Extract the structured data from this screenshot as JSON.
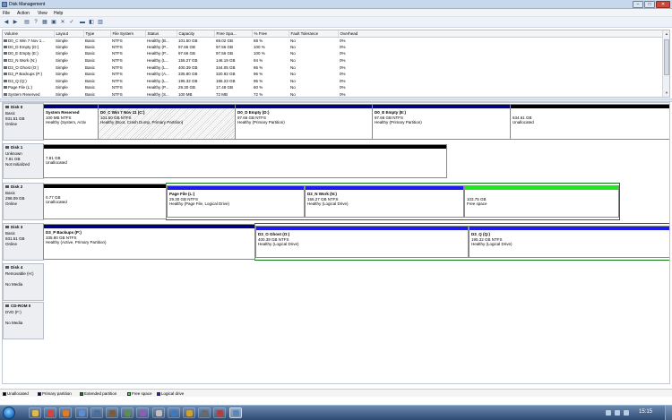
{
  "window": {
    "title": "Disk Management"
  },
  "window_controls": {
    "minimize": "–",
    "maximize": "□",
    "close": "✕"
  },
  "menu": [
    {
      "label": "File"
    },
    {
      "label": "Action"
    },
    {
      "label": "View"
    },
    {
      "label": "Help"
    }
  ],
  "toolbar": [
    {
      "name": "back-icon",
      "glyph": "◀"
    },
    {
      "name": "forward-icon",
      "glyph": "▶"
    },
    {
      "name": "console-tree-icon",
      "glyph": "▤"
    },
    {
      "name": "help-icon",
      "glyph": "?"
    },
    {
      "name": "properties-icon",
      "glyph": "▦"
    },
    {
      "name": "connect-drive-icon",
      "glyph": "▣"
    },
    {
      "name": "delete-icon",
      "glyph": "✕"
    },
    {
      "name": "check-icon",
      "glyph": "✓"
    },
    {
      "name": "open-folder-icon",
      "glyph": "▬"
    },
    {
      "name": "explore-icon",
      "glyph": "◧"
    },
    {
      "name": "view-icon",
      "glyph": "▥"
    }
  ],
  "volumes": {
    "columns": [
      "Volume",
      "Layout",
      "Type",
      "File System",
      "Status",
      "Capacity",
      "Free Spa...",
      "% Free",
      "Fault Tolerance",
      "Overhead"
    ],
    "rows": [
      [
        "D0_C Win 7 Nov 1...",
        "Simple",
        "Basic",
        "NTFS",
        "Healthy (B...",
        "101.50 GB",
        "69.02 GB",
        "68 %",
        "No",
        "0%"
      ],
      [
        "D0_D Empty (D:)",
        "Simple",
        "Basic",
        "NTFS",
        "Healthy (P...",
        "97.66 GB",
        "97.56 GB",
        "100 %",
        "No",
        "0%"
      ],
      [
        "D0_E Empty (E:)",
        "Simple",
        "Basic",
        "NTFS",
        "Healthy (P...",
        "97.66 GB",
        "97.56 GB",
        "100 %",
        "No",
        "0%"
      ],
      [
        "D2_N Work (N:)",
        "Simple",
        "Basic",
        "NTFS",
        "Healthy (L...",
        "155.27 GB",
        "146.19 GB",
        "94 %",
        "No",
        "0%"
      ],
      [
        "D3_O Ghost (O:)",
        "Simple",
        "Basic",
        "NTFS",
        "Healthy (L...",
        "400.39 GB",
        "344.05 GB",
        "86 %",
        "No",
        "0%"
      ],
      [
        "D3_P Backups (P:)",
        "Simple",
        "Basic",
        "NTFS",
        "Healthy (A...",
        "335.80 GB",
        "320.92 GB",
        "96 %",
        "No",
        "0%"
      ],
      [
        "D3_Q (Q:)",
        "Simple",
        "Basic",
        "NTFS",
        "Healthy (L...",
        "195.32 GB",
        "186.23 GB",
        "95 %",
        "No",
        "0%"
      ],
      [
        "Page File (L:)",
        "Simple",
        "Basic",
        "NTFS",
        "Healthy (P...",
        "29.30 GB",
        "17.48 GB",
        "60 %",
        "No",
        "0%"
      ],
      [
        "System Reserved",
        "Simple",
        "Basic",
        "NTFS",
        "Healthy (S...",
        "100 MB",
        "72 MB",
        "72 %",
        "No",
        "0%"
      ]
    ]
  },
  "disks": [
    {
      "name": "Disk 0",
      "lines": [
        "Basic",
        "931.51 GB",
        "Online"
      ],
      "partitions": [
        {
          "kind": "primary",
          "lines": [
            "System Reserved",
            "100 MB NTFS",
            "Healthy (System, Activ"
          ]
        },
        {
          "kind": "primary-selected",
          "lines": [
            "D0_C Win 7 Nov 11  (C:)",
            "101.50 GB NTFS",
            "Healthy (Boot, Crash Dump, Primary Partition)"
          ]
        },
        {
          "kind": "primary",
          "lines": [
            "D0_D Empty  (D:)",
            "97.66 GB NTFS",
            "Healthy (Primary Partition)"
          ]
        },
        {
          "kind": "primary",
          "lines": [
            "D0_E Empty  (E:)",
            "97.66 GB NTFS",
            "Healthy (Primary Partition)"
          ]
        },
        {
          "kind": "unallocated",
          "lines": [
            "",
            "634.61 GB",
            "Unallocated"
          ]
        }
      ]
    },
    {
      "name": "Disk 1",
      "lines": [
        "Unknown",
        "7.81 GB",
        "Not Initialized"
      ],
      "partitions": [
        {
          "kind": "unallocated",
          "lines": [
            "",
            "7.81 GB",
            "Unallocated"
          ]
        }
      ]
    },
    {
      "name": "Disk 2",
      "lines": [
        "Basic",
        "298.09 GB",
        "Online"
      ],
      "partitions": [
        {
          "kind": "unallocated",
          "lines": [
            "",
            "0.77 GB",
            "Unallocated"
          ]
        },
        {
          "kind": "logical",
          "lines": [
            "Page File  (L:)",
            "29.30 GB NTFS",
            "Healthy (Page File, Logical Drive)"
          ]
        },
        {
          "kind": "logical",
          "lines": [
            "D2_N Work  (N:)",
            "155.27 GB NTFS",
            "Healthy (Logical Drive)"
          ]
        },
        {
          "kind": "free",
          "lines": [
            "",
            "103.75 GB",
            "Free space"
          ]
        }
      ]
    },
    {
      "name": "Disk 3",
      "lines": [
        "Basic",
        "931.51 GB",
        "Online"
      ],
      "partitions": [
        {
          "kind": "primary",
          "lines": [
            "D3_P Backups  (P:)",
            "335.80 GB NTFS",
            "Healthy (Active, Primary Partition)"
          ]
        },
        {
          "kind": "logical",
          "lines": [
            "D3_O Ghost  (O:)",
            "400.39 GB NTFS",
            "Healthy (Logical Drive)"
          ]
        },
        {
          "kind": "logical",
          "lines": [
            "D3_Q  (Q:)",
            "195.32 GB NTFS",
            "Healthy (Logical Drive)"
          ]
        }
      ]
    },
    {
      "name": "Disk 4",
      "lines": [
        "Removable (H:)",
        "",
        "No Media"
      ],
      "partitions": []
    },
    {
      "name": "CD-ROM 0",
      "lines": [
        "DVD (F:)",
        "",
        "No Media"
      ],
      "partitions": []
    }
  ],
  "legend": [
    {
      "label": "Unallocated",
      "color": "#000000"
    },
    {
      "label": "Primary partition",
      "color": "#00007a"
    },
    {
      "label": "Extended partition",
      "color": "#0a7a0a"
    },
    {
      "label": "Free space",
      "color": "#1ee81e"
    },
    {
      "label": "Logical drive",
      "color": "#1c1cf0"
    }
  ],
  "colors": {
    "unallocated": "#000000",
    "primary": "#00007a",
    "extended": "#0a7a0a",
    "free": "#1ee81e",
    "logical": "#1c1cf0"
  },
  "taskbar": {
    "apps": [
      {
        "name": "explorer-icon",
        "color": "#e2b84a"
      },
      {
        "name": "chrome-icon",
        "color": "#d9443a"
      },
      {
        "name": "firefox-icon",
        "color": "#e07b2a"
      },
      {
        "name": "media-player-icon",
        "color": "#5a8fd0"
      },
      {
        "name": "app-icon",
        "color": "#4a6f9a"
      },
      {
        "name": "app-icon",
        "color": "#7d5a3a"
      },
      {
        "name": "app-icon",
        "color": "#5b8f4a"
      },
      {
        "name": "app-icon",
        "color": "#8a5fb0"
      },
      {
        "name": "app-icon",
        "color": "#c0c0c0"
      },
      {
        "name": "app-icon",
        "color": "#3a7ac0"
      },
      {
        "name": "app-icon",
        "color": "#d0a030"
      },
      {
        "name": "app-icon",
        "color": "#6a6a6a"
      },
      {
        "name": "app-icon",
        "color": "#b04040"
      },
      {
        "name": "disk-management-icon",
        "color": "#5d86b8"
      }
    ],
    "clock": "15:15"
  }
}
